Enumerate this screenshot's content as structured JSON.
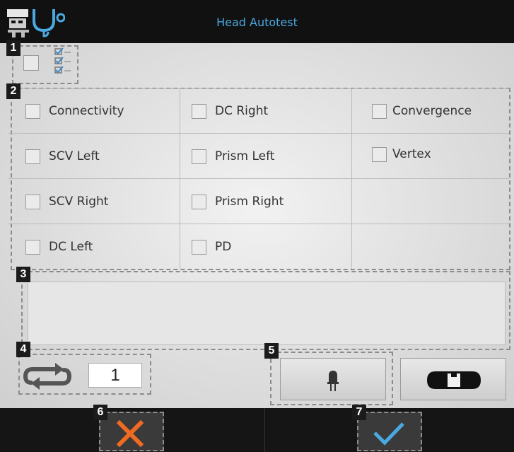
{
  "window": {
    "title": "Head Autotest"
  },
  "icons": {
    "app": "autotest-app-icon",
    "select_all_list": "multi-check-list-icon",
    "repeat": "repeat-icon",
    "led": "led-icon",
    "level": "level-icon",
    "cancel": "cancel-x-icon",
    "confirm": "confirm-check-icon"
  },
  "badges": [
    "1",
    "2",
    "3",
    "4",
    "5",
    "6",
    "7"
  ],
  "tests": {
    "rows": [
      [
        "Connectivity",
        "DC Right",
        "Convergence"
      ],
      [
        "SCV Left",
        "Prism Left",
        "Vertex"
      ],
      [
        "SCV Right",
        "Prism Right",
        ""
      ],
      [
        "DC Left",
        "PD",
        ""
      ]
    ]
  },
  "repeat": {
    "count": "1"
  },
  "colors": {
    "title": "#4aa9e0",
    "cancel": "#f06a21",
    "confirm": "#4aa9e0",
    "bar": "#111111"
  }
}
